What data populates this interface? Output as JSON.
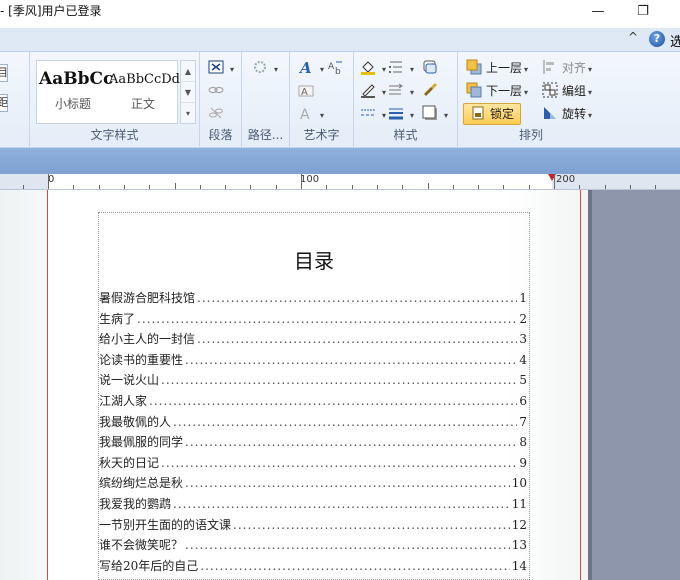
{
  "titlebar": {
    "title": "- [季风]用户已登录",
    "min_glyph": "—",
    "max_glyph": "❐"
  },
  "tabsbar": {
    "collapse_glyph": "^",
    "help_glyph": "?",
    "help_text": "选"
  },
  "ribbon": {
    "left_edge_buttons": [
      "目",
      "距"
    ],
    "text_styles": {
      "label": "文字样式",
      "items": [
        {
          "preview": "AaBbCc",
          "name": "小标题"
        },
        {
          "preview": "AaBbCcDd",
          "name": "正文"
        }
      ]
    },
    "paragraph": {
      "label": "段落"
    },
    "path": {
      "label": "路径..."
    },
    "wordart": {
      "label": "艺术字"
    },
    "style": {
      "label": "样式"
    },
    "arrange": {
      "label": "排列",
      "bring_forward": "上一层",
      "send_backward": "下一层",
      "lock": "锁定",
      "align": "对齐",
      "group": "编组",
      "rotate": "旋转"
    },
    "arrow_glyph": "▾"
  },
  "ruler": {
    "labels": [
      "0",
      "100",
      "200"
    ]
  },
  "document": {
    "toc_title": "目录",
    "entries": [
      {
        "title": "暑假游合肥科技馆",
        "page": "1"
      },
      {
        "title": "生病了",
        "page": "2"
      },
      {
        "title": "给小主人的一封信",
        "page": "3"
      },
      {
        "title": "论读书的重要性",
        "page": "4"
      },
      {
        "title": "说一说火山",
        "page": "5"
      },
      {
        "title": "江湖人家",
        "page": "6"
      },
      {
        "title": "我最敬佩的人",
        "page": "7"
      },
      {
        "title": "我最佩服的同学",
        "page": "8"
      },
      {
        "title": "秋天的日记",
        "page": "9"
      },
      {
        "title": "缤纷绚烂总是秋",
        "page": "10"
      },
      {
        "title": "我爱我的鹦鹉",
        "page": "11"
      },
      {
        "title": "一节别开生面的的语文课",
        "page": "12"
      },
      {
        "title": "谁不会微笑呢？",
        "page": "13"
      },
      {
        "title": "写给20年后的自己",
        "page": "14"
      }
    ]
  },
  "colors": {
    "ribbon_bg": "#e4edf8",
    "band": "#7ea1d2",
    "lock_highlight": "#ffcc52",
    "margin_line": "#d44444",
    "pasteboard": "#8d96aa"
  }
}
